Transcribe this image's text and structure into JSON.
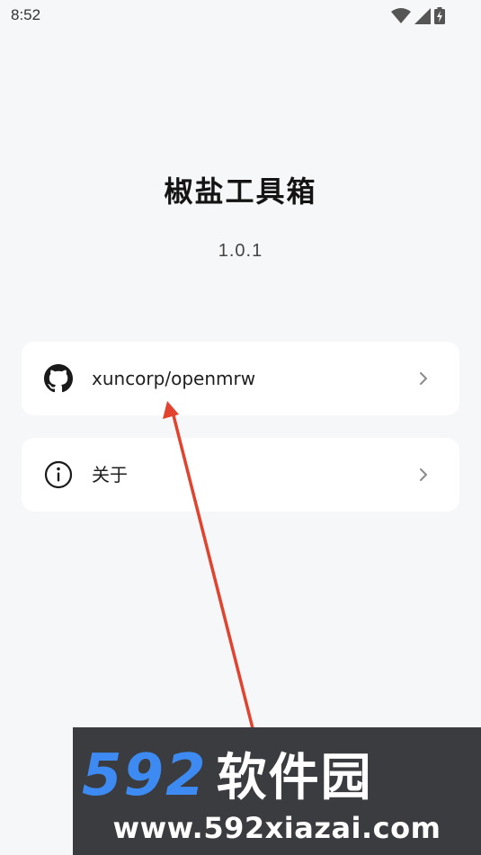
{
  "status_bar": {
    "time": "8:52",
    "icons": [
      "wifi-icon",
      "signal-icon",
      "battery-charging-icon"
    ]
  },
  "app": {
    "title": "椒盐工具箱",
    "version": "1.0.1"
  },
  "menu": {
    "items": [
      {
        "label": "xuncorp/openmrw",
        "icon": "github-icon"
      },
      {
        "label": "关于",
        "icon": "info-icon"
      }
    ]
  },
  "colors": {
    "background": "#f6f7f9",
    "card": "#ffffff",
    "annotation_arrow": "#e2432f",
    "watermark_bg": "#3b3c3f",
    "watermark_digits": "#3d8bf2"
  },
  "watermark": {
    "digits": "592",
    "brand": "软件园",
    "url": "www.592xiazai.com"
  }
}
